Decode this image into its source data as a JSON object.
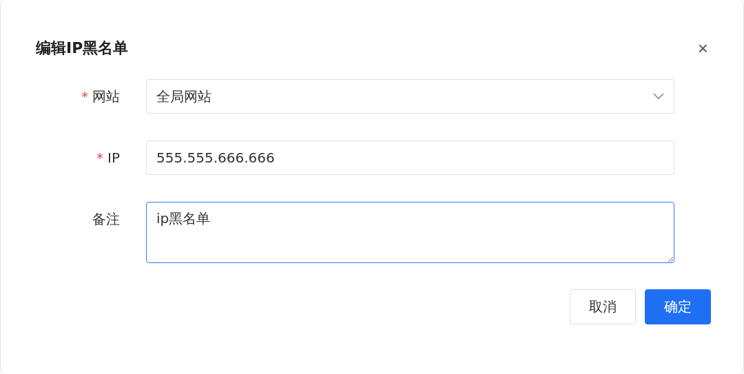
{
  "dialog": {
    "title": "编辑IP黑名单",
    "close": "×"
  },
  "fields": [
    {
      "kind": "select",
      "label": "网站",
      "required_mark": "*",
      "focused": false,
      "value": "全局网站"
    },
    {
      "kind": "input",
      "label": "IP",
      "required_mark": "*",
      "focused": false,
      "value": "555.555.666.666"
    },
    {
      "kind": "textarea",
      "label": "备注",
      "focused": true,
      "value": "ip黑名单"
    }
  ],
  "buttons": [
    {
      "label": "取消",
      "primary": false
    },
    {
      "label": "确定",
      "primary": true
    }
  ]
}
